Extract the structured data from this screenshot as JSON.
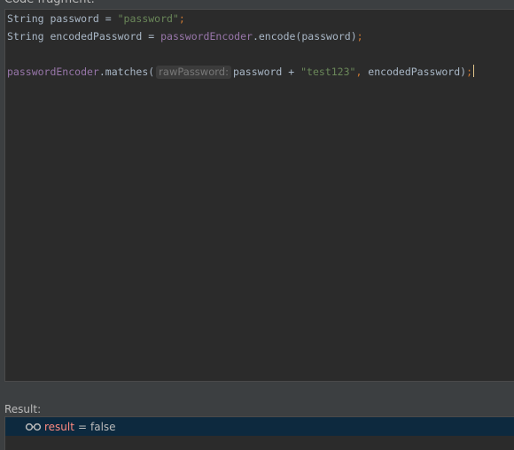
{
  "window": {
    "title": "Code fragment:"
  },
  "editor": {
    "line1": {
      "p1": "String password = ",
      "s1": "\"password\"",
      "semi": ";"
    },
    "line2": {
      "p1": "String encodedPassword = ",
      "field": "passwordEncoder",
      "p2": ".encode(password)",
      "semi": ";"
    },
    "line4": {
      "field": "passwordEncoder",
      "p1": ".matches(",
      "hint": "rawPassword:",
      "p2": "password + ",
      "s1": "\"test123\"",
      "comma": ",",
      "p3": " encodedPassword)",
      "semi": ";"
    }
  },
  "result": {
    "label": "Result:",
    "icon": "watch-glasses-icon",
    "name": "result",
    "equals": "=",
    "value": "false"
  },
  "colors": {
    "keyword_plain": "#a9b7c6",
    "string": "#6a8759",
    "field": "#9876aa",
    "punct": "#cc7832",
    "result_name": "#ff8a80",
    "selection": "#0d293e"
  }
}
